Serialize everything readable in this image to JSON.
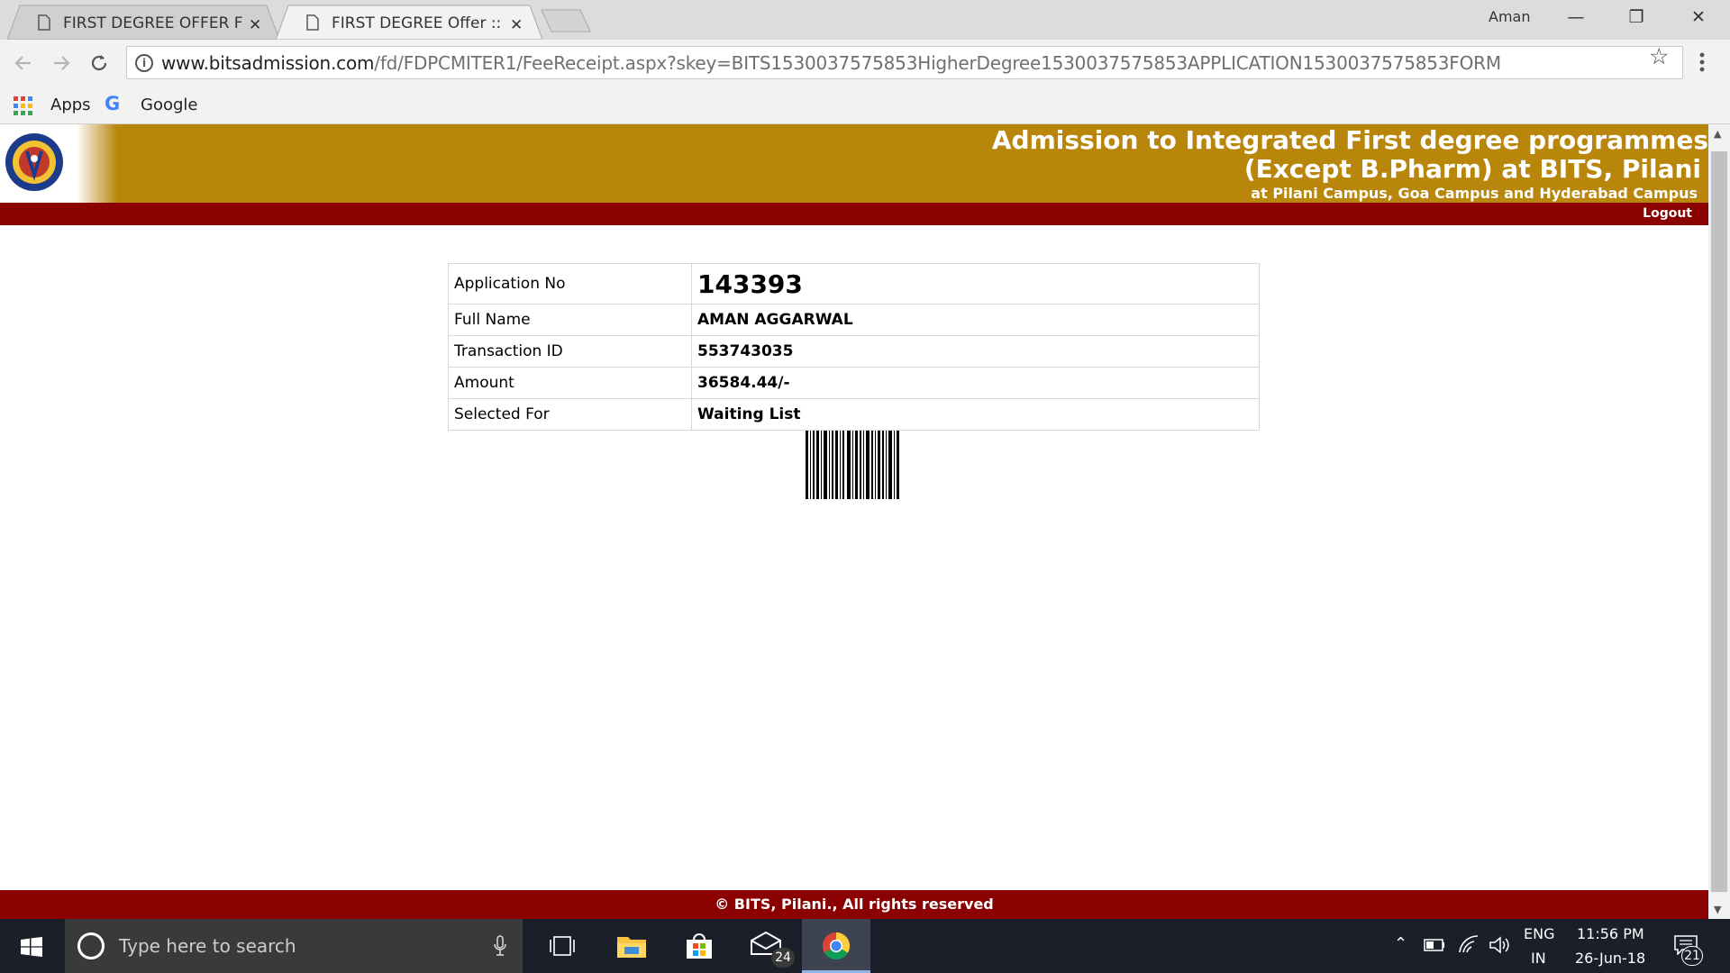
{
  "browser": {
    "tabs": [
      {
        "title": "FIRST DEGREE OFFER For",
        "active": false
      },
      {
        "title": "FIRST DEGREE Offer :: Bits",
        "active": true
      }
    ],
    "profile_name": "Aman",
    "url_host": "www.bitsadmission.com",
    "url_path": "/fd/FDPCMITER1/FeeReceipt.aspx?skey=BITS1530037575853HigherDegree1530037575853APPLICATION1530037575853FORM",
    "bookmarks": {
      "apps": "Apps",
      "google": "Google"
    }
  },
  "page": {
    "header_line1": "Admission to Integrated First degree programmes",
    "header_line2": "(Except B.Pharm) at BITS, Pilani",
    "header_line3": "at Pilani Campus, Goa Campus and Hyderabad Campus",
    "logout": "Logout",
    "receipt": [
      {
        "label": "Application No",
        "value": "143393"
      },
      {
        "label": "Full Name",
        "value": "AMAN AGGARWAL"
      },
      {
        "label": "Transaction ID",
        "value": "553743035"
      },
      {
        "label": "Amount",
        "value": "36584.44/-"
      },
      {
        "label": "Selected For",
        "value": "Waiting List"
      }
    ],
    "footer": "© BITS, Pilani., All rights reserved"
  },
  "taskbar": {
    "search_placeholder": "Type here to search",
    "mail_badge": "24",
    "lang_line1": "ENG",
    "lang_line2": "IN",
    "time": "11:56 PM",
    "date": "26-Jun-18",
    "notification_count": "21"
  },
  "colors": {
    "banner": "#b8860b",
    "red_bar": "#8b0000",
    "taskbar": "#1b1f2a"
  }
}
